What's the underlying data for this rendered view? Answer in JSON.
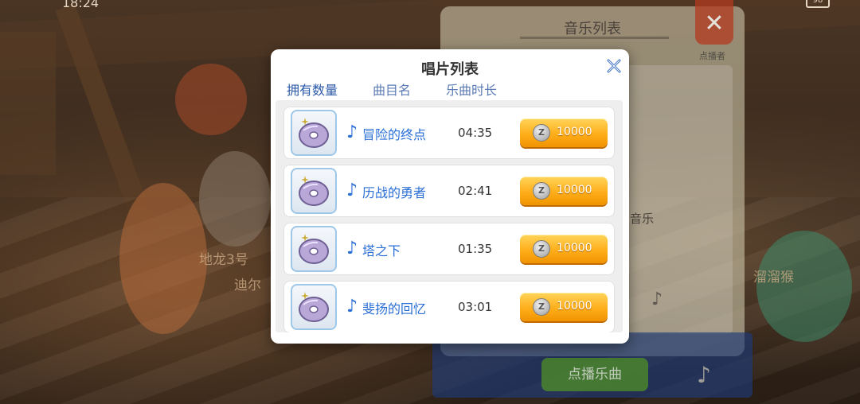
{
  "status": {
    "time": "18:24",
    "battery": "98"
  },
  "scene": {
    "labels": [
      "地龙3号",
      "迪尔",
      "溜溜猴"
    ]
  },
  "music_panel": {
    "title": "音乐列表",
    "requester_label": "点播者",
    "text_fragment": "音乐",
    "request_button": "点播乐曲"
  },
  "dialog": {
    "title": "唱片列表",
    "columns": [
      "拥有数量",
      "曲目名",
      "乐曲时长"
    ],
    "rows": [
      {
        "name": "冒险的终点",
        "duration": "04:35",
        "price": "10000"
      },
      {
        "name": "历战的勇者",
        "duration": "02:41",
        "price": "10000"
      },
      {
        "name": "塔之下",
        "duration": "01:35",
        "price": "10000"
      },
      {
        "name": "斐扬的回忆",
        "duration": "03:01",
        "price": "10000"
      }
    ],
    "note_glyph": "♪",
    "coin_glyph": "Z"
  },
  "colors": {
    "accent_blue": "#2a6fd6",
    "button_orange": "#ffae1a",
    "close_red": "#b23a1f"
  }
}
